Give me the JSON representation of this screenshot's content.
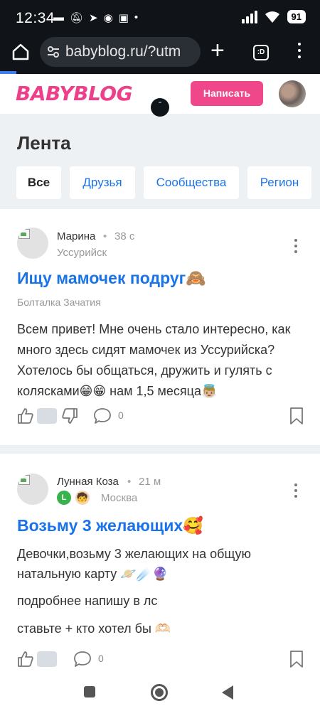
{
  "status_bar": {
    "time": "12:34",
    "left_icons": [
      "bed-icon",
      "mute-icon",
      "telegram-icon",
      "vpn-icon",
      "cast-icon"
    ],
    "right_icons": [
      "signal-icon",
      "wifi-icon"
    ],
    "battery": "91"
  },
  "browser": {
    "url": "babyblog.ru/?utm",
    "tabs_label": ":D",
    "loading_progress": 0.05
  },
  "site": {
    "logo": "BABYBLOG",
    "write_button": "Написать",
    "accent_color": "#f0468a",
    "link_color": "#1a73e8"
  },
  "feed": {
    "title": "Лента",
    "tabs": [
      "Все",
      "Друзья",
      "Сообщества",
      "Регион"
    ],
    "active_tab": "Все"
  },
  "posts": [
    {
      "author": "Марина",
      "separator": "•",
      "ago": "38 с",
      "city": "Уссурийск",
      "title": "Ищу мамочек подруг🙈",
      "community": "Болталка Зачатия",
      "text": "Всем привет! Мне очень стало интересно, как много здесь сидят мамочек из Уссурийска? Хотелось бы общаться, дружить и гулять с колясками😁😁 нам 1,5 месяца👼🏼",
      "comments": "0"
    },
    {
      "author": "Лунная Коза",
      "separator": "•",
      "ago": "21 м",
      "city": "Москва",
      "title": "Возьму 3 желающих🥰",
      "lines": [
        "Девочки,возьму 3 желающих на общую",
        "натальную карту 🪐☄️🔮",
        "подробнее напишу в лс",
        "ставьте + кто хотел бы 🫶🏻"
      ],
      "comments": "0"
    }
  ]
}
